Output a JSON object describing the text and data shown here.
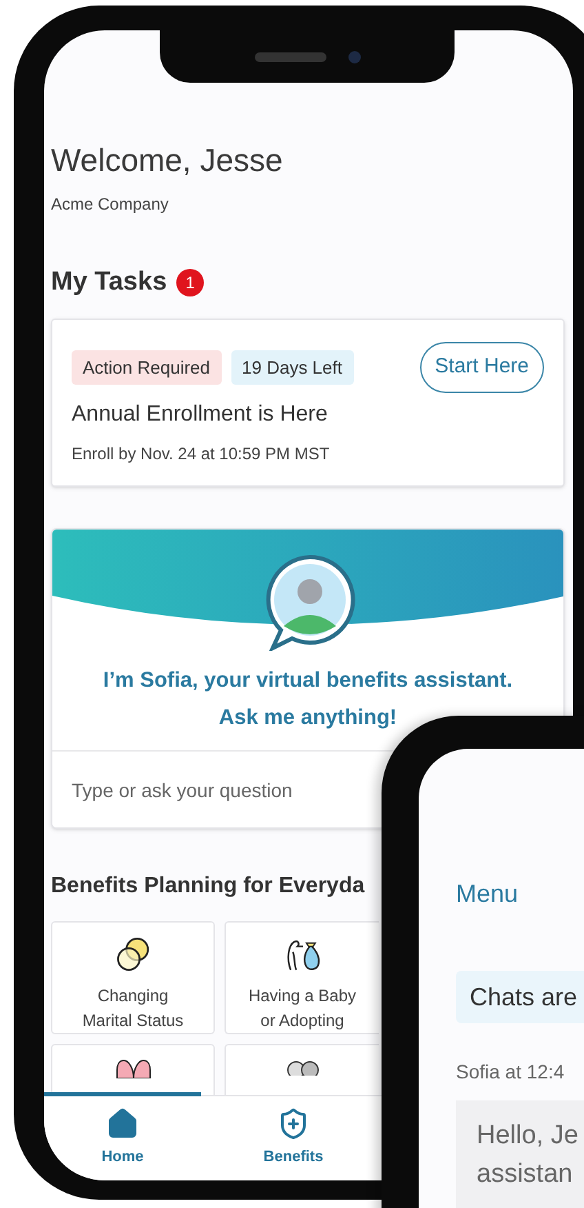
{
  "greeting": {
    "title": "Welcome, Jesse",
    "company": "Acme Company"
  },
  "tasks": {
    "title": "My Tasks",
    "count": "1",
    "items": [
      {
        "tags": [
          {
            "label": "Action Required",
            "color": "#fbe3e3"
          },
          {
            "label": "19 Days Left",
            "color": "#e3f3fa"
          }
        ],
        "button": "Start Here",
        "title": "Annual Enrollment is Here",
        "due": "Enroll by Nov. 24 at 10:59 PM MST"
      }
    ]
  },
  "assistant": {
    "message": "I’m Sofia, your virtual benefits assistant.",
    "prompt": "Ask me anything!",
    "input": {
      "placeholder": "Type or ask your question"
    }
  },
  "planning": {
    "title": "Benefits Planning for Everyda",
    "tiles": [
      {
        "kind": "rings",
        "label": "Changing Marital Status"
      },
      {
        "kind": "baby",
        "label": "Having a Baby or Adopting"
      },
      {
        "kind": "heart"
      },
      {
        "kind": "people"
      }
    ]
  },
  "nav": [
    {
      "kind": "home",
      "label": "Home",
      "selected": true
    },
    {
      "kind": "benefits",
      "label": "Benefits",
      "selected": false
    }
  ],
  "second_screen": {
    "menu": "Menu",
    "notice": "Chats are",
    "sender": "Sofia at 12:4",
    "message_lines": [
      "Hello, Je",
      "assistan"
    ]
  }
}
